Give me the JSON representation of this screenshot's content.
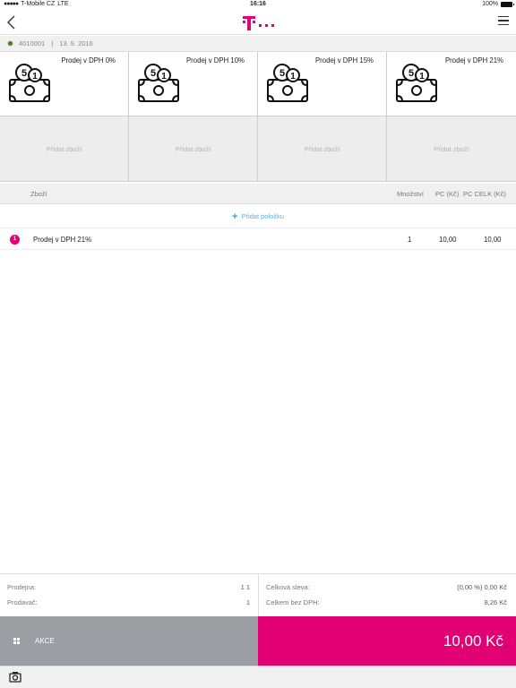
{
  "status": {
    "carrier": "T-Mobile CZ",
    "network": "LTE",
    "time": "16:16",
    "battery": "100%"
  },
  "info": {
    "register_id": "4010001",
    "separator": "|",
    "date": "13. 9. 2016"
  },
  "products": [
    {
      "label": "Prodej v DPH 0%",
      "icon": "cash-coins-icon"
    },
    {
      "label": "Prodej v DPH 10%",
      "icon": "cash-coins-icon"
    },
    {
      "label": "Prodej v DPH 15%",
      "icon": "cash-coins-icon"
    },
    {
      "label": "Prodej v DPH 21%",
      "icon": "cash-coins-icon"
    }
  ],
  "empty_slots": [
    {
      "label": "Přidat zboží"
    },
    {
      "label": "Přidat zboží"
    },
    {
      "label": "Přidat zboží"
    },
    {
      "label": "Přidat zboží"
    }
  ],
  "table": {
    "columns": {
      "item": "Zboží",
      "qty": "Množství",
      "unit_price": "PC (Kč)",
      "total_price": "PC CELK (Kč)"
    },
    "add_item": "Přidat položku",
    "rows": [
      {
        "index": "1",
        "name": "Prodej v DPH 21%",
        "qty": "1",
        "unit_price": "10,00",
        "total_price": "10,00"
      }
    ]
  },
  "summary": {
    "store_label": "Prodejna:",
    "store_value": "1 1",
    "seller_label": "Prodavač:",
    "seller_value": "1",
    "discount_label": "Celková sleva:",
    "discount_value": "(0,00 %) 0,00 Kč",
    "net_label": "Celkem bez DPH:",
    "net_value": "8,26 Kč"
  },
  "actions": {
    "akce_label": "AKCE",
    "total": "10,00 Kč"
  },
  "colors": {
    "brand": "#e20074",
    "action_gray": "#9b9ea2",
    "link_blue": "#3a9bd8"
  }
}
